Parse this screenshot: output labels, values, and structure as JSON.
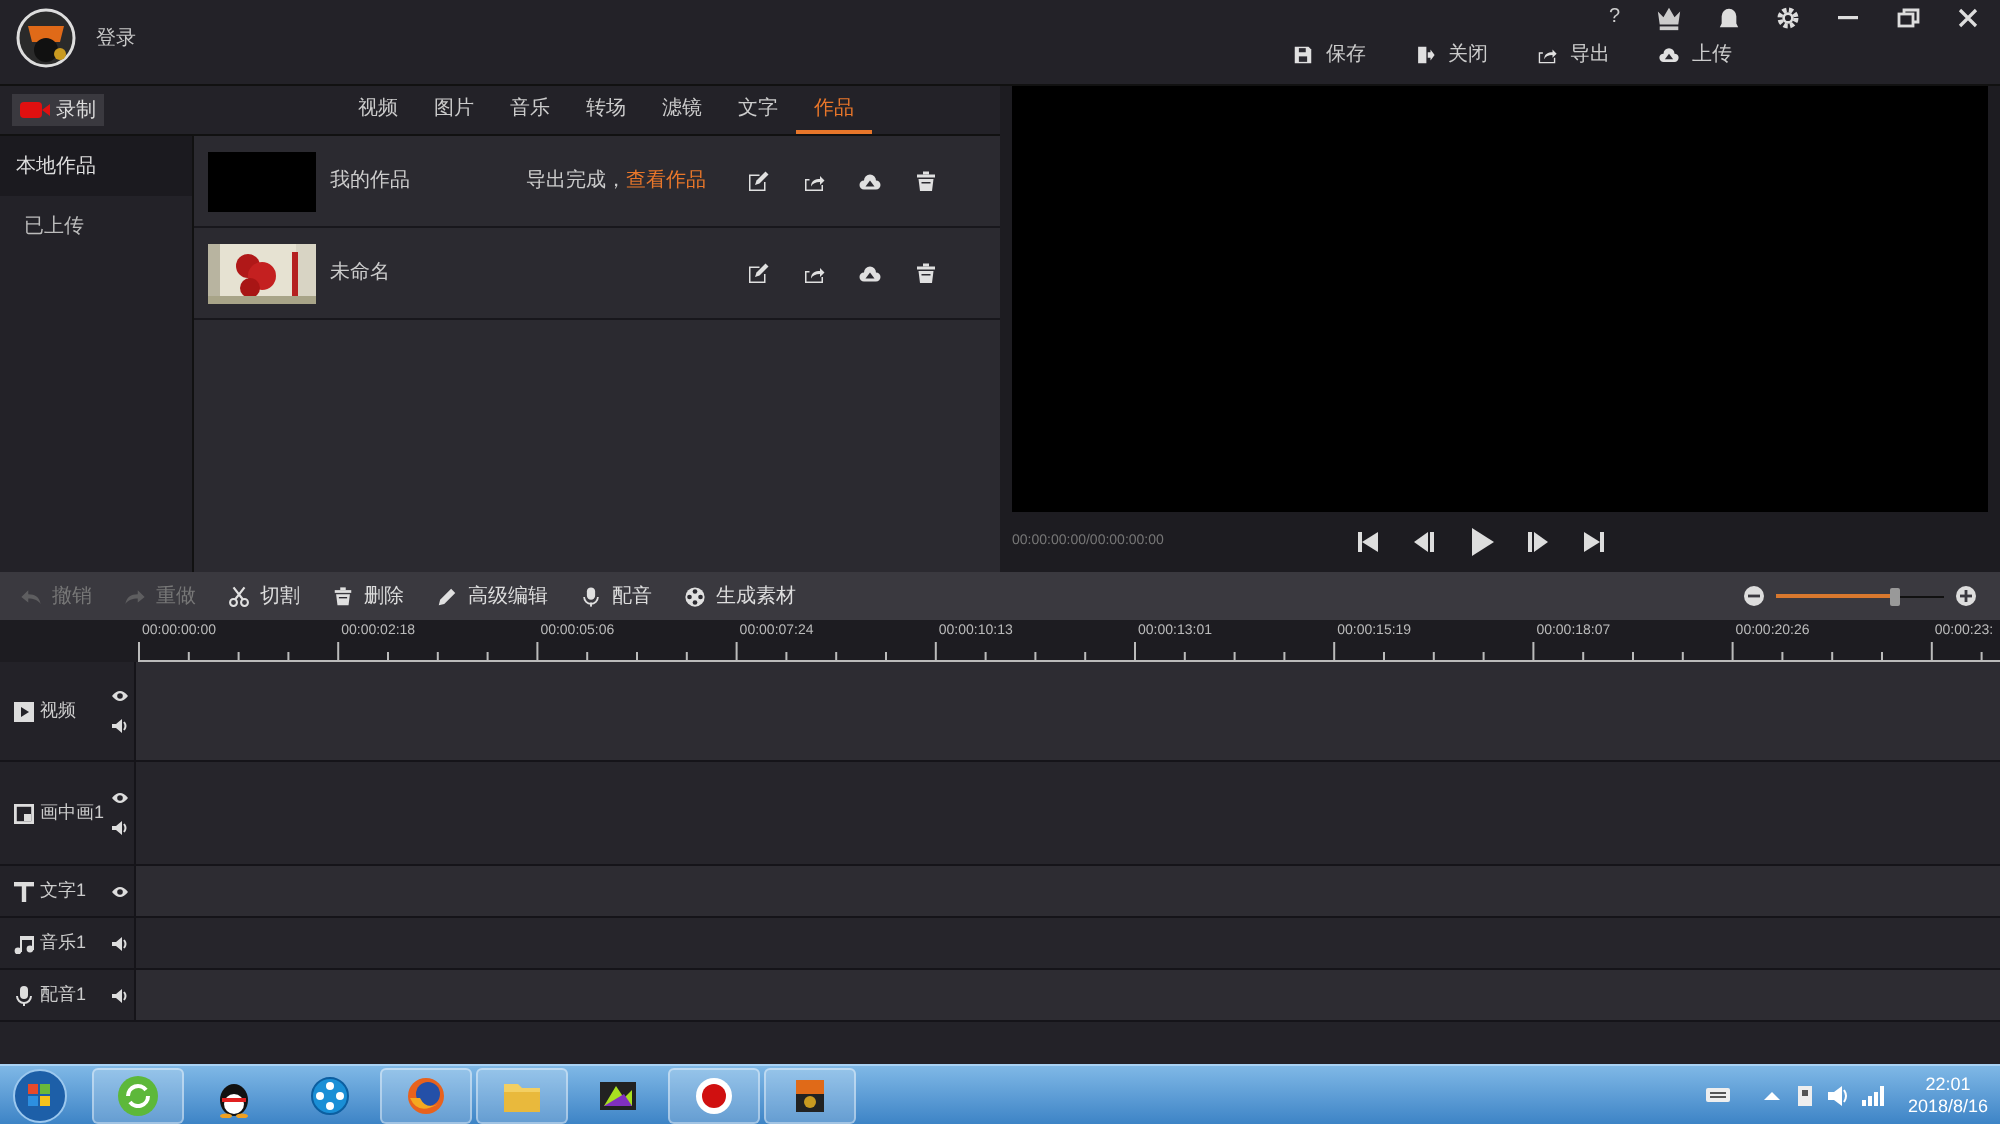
{
  "header": {
    "login": "登录",
    "actions": [
      {
        "label": "保存"
      },
      {
        "label": "关闭"
      },
      {
        "label": "导出"
      },
      {
        "label": "上传"
      }
    ],
    "help": "?"
  },
  "record_button": "录制",
  "tabs": [
    {
      "label": "视频",
      "selected": false
    },
    {
      "label": "图片",
      "selected": false
    },
    {
      "label": "音乐",
      "selected": false
    },
    {
      "label": "转场",
      "selected": false
    },
    {
      "label": "滤镜",
      "selected": false
    },
    {
      "label": "文字",
      "selected": false
    },
    {
      "label": "作品",
      "selected": true
    }
  ],
  "sidebar": {
    "items": [
      {
        "label": "本地作品",
        "selected": true
      },
      {
        "label": "已上传",
        "selected": false
      }
    ]
  },
  "works": [
    {
      "name": "我的作品",
      "kind": "blank",
      "status": "导出完成，",
      "link": "查看作品"
    },
    {
      "name": "未命名",
      "kind": "picture"
    }
  ],
  "preview": {
    "time": "00:00:00:00/00:00:00:00"
  },
  "toolbar": [
    {
      "label": "撤销",
      "disabled": true
    },
    {
      "label": "重做",
      "disabled": true
    },
    {
      "label": "切割",
      "disabled": false
    },
    {
      "label": "删除",
      "disabled": false
    },
    {
      "label": "高级编辑",
      "disabled": false
    },
    {
      "label": "配音",
      "disabled": false
    },
    {
      "label": "生成素材",
      "disabled": false
    }
  ],
  "zoom": {
    "level": 0.7
  },
  "ruler": [
    "00:00:00:00",
    "00:00:02:18",
    "00:00:05:06",
    "00:00:07:24",
    "00:00:10:13",
    "00:00:13:01",
    "00:00:15:19",
    "00:00:18:07",
    "00:00:20:26",
    "00:00:23:"
  ],
  "tracks": [
    {
      "kind": "video",
      "label": "视频"
    },
    {
      "kind": "pip",
      "label": "画中画1"
    },
    {
      "kind": "text",
      "label": "文字1"
    },
    {
      "kind": "music",
      "label": "音乐1"
    },
    {
      "kind": "voice",
      "label": "配音1"
    }
  ],
  "taskbar": {
    "time": "22:01",
    "date": "2018/8/16"
  }
}
